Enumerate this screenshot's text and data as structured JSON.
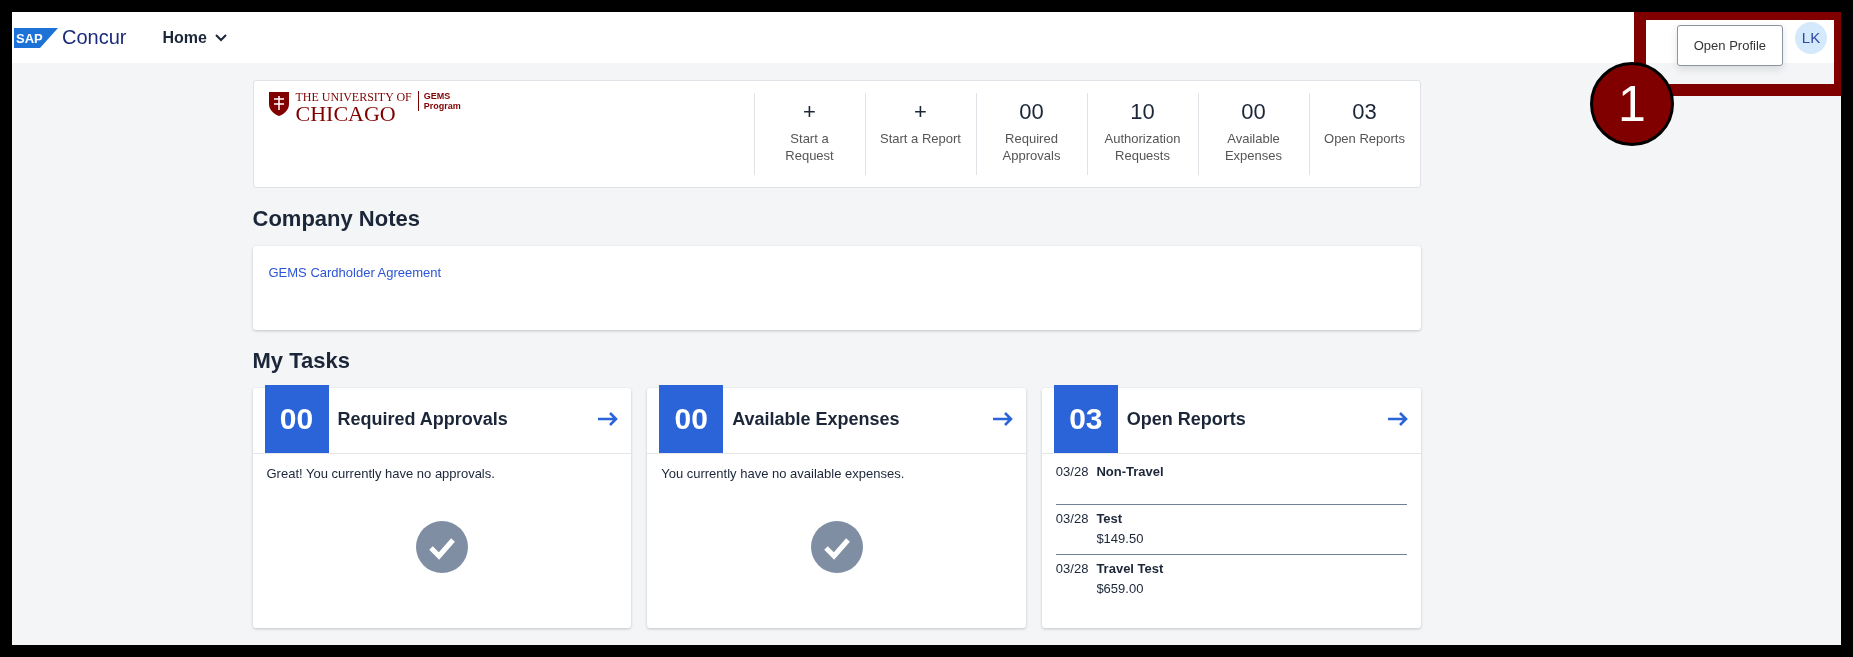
{
  "header": {
    "brand": "Concur",
    "logo_mark": "SAP",
    "nav": {
      "label": "Home"
    },
    "tooltip": "Open Profile",
    "avatar": "LK"
  },
  "summary": {
    "org_lines": [
      "THE UNIVERSITY OF",
      "CHICAGO"
    ],
    "program_lines": [
      "GEMS",
      "Program"
    ],
    "stats": [
      {
        "value": "+",
        "label": "Start a Request"
      },
      {
        "value": "+",
        "label": "Start a Report"
      },
      {
        "value": "00",
        "label": "Required Approvals"
      },
      {
        "value": "10",
        "label": "Authorization Requests"
      },
      {
        "value": "00",
        "label": "Available Expenses"
      },
      {
        "value": "03",
        "label": "Open Reports"
      }
    ]
  },
  "company_notes": {
    "heading": "Company Notes",
    "links": [
      "GEMS Cardholder Agreement"
    ]
  },
  "my_tasks": {
    "heading": "My Tasks",
    "cards": [
      {
        "kind": "message",
        "count": "00",
        "title": "Required Approvals",
        "message": "Great! You currently have no approvals."
      },
      {
        "kind": "message",
        "count": "00",
        "title": "Available Expenses",
        "message": "You currently have no available expenses."
      },
      {
        "kind": "list",
        "count": "03",
        "title": "Open Reports",
        "items": [
          {
            "date": "03/28",
            "name": "Non-Travel"
          },
          {
            "date": "03/28",
            "name": "Test",
            "amount": "$149.50"
          },
          {
            "date": "03/28",
            "name": "Travel Test",
            "amount": "$659.00"
          }
        ]
      }
    ]
  },
  "callout": {
    "number": "1"
  }
}
